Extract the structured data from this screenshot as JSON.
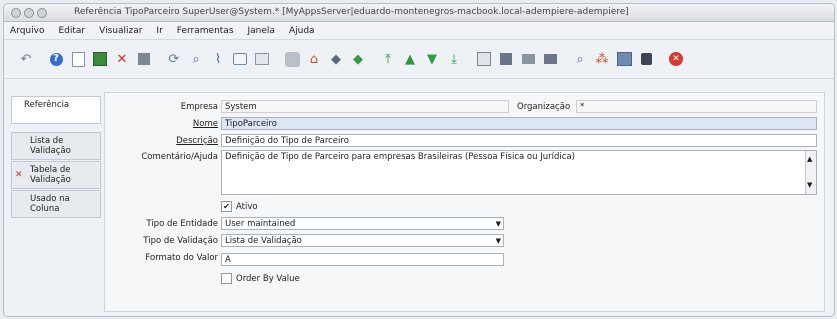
{
  "window": {
    "title": "Referência  TipoParceiro  SuperUser@System.* [MyAppsServer|eduardo-montenegros-macbook.local-adempiere-adempiere]"
  },
  "menubar": [
    "Arquivo",
    "Editar",
    "Visualizar",
    "Ir",
    "Ferramentas",
    "Janela",
    "Ajuda"
  ],
  "toolbar": {
    "icons": [
      "undo-icon",
      "help-icon",
      "new-record-icon",
      "save-icon",
      "delete-icon",
      "copy-icon",
      "refresh-icon",
      "find-icon",
      "attachment-icon",
      "chat-icon",
      "grid-toggle-icon",
      "history-icon",
      "home-icon",
      "previous-icon",
      "next-icon",
      "first-record-icon",
      "up-icon",
      "down-icon",
      "last-record-icon",
      "report-icon",
      "archive-icon",
      "print-preview-icon",
      "print-icon",
      "zoom-across-icon",
      "active-workflows-icon",
      "product-info-icon",
      "lock-icon",
      "close-window-icon"
    ]
  },
  "sidetabs": [
    {
      "label": "Referência",
      "active": true,
      "error": false
    },
    {
      "label": "Lista de Validação",
      "active": false,
      "error": false
    },
    {
      "label": "Tabela de Validação",
      "active": false,
      "error": true
    },
    {
      "label": "Usado na Coluna",
      "active": false,
      "error": false
    }
  ],
  "form": {
    "empresa_label": "Empresa",
    "empresa_value": "System",
    "organizacao_label": "Organização",
    "organizacao_value": "*",
    "nome_label": "Nome",
    "nome_value": "TipoParceiro",
    "descricao_label": "Descrição",
    "descricao_value": "Definição do Tipo de Parceiro",
    "comentario_label": "Comentário/Ajuda",
    "comentario_value": "Definição de Tipo de Parceiro para empresas Brasileiras (Pessoa Física ou Jurídica)",
    "ativo_label": "Ativo",
    "ativo_checked": true,
    "tipo_entidade_label": "Tipo de Entidade",
    "tipo_entidade_value": "User maintained",
    "tipo_validacao_label": "Tipo de Validação",
    "tipo_validacao_value": "Lista de Validação",
    "formato_label": "Formato do Valor",
    "formato_value": "A",
    "order_label": "Order By Value",
    "order_checked": false
  },
  "colors": {
    "required_bg": "#dde6f5",
    "error": "#d0322b"
  }
}
